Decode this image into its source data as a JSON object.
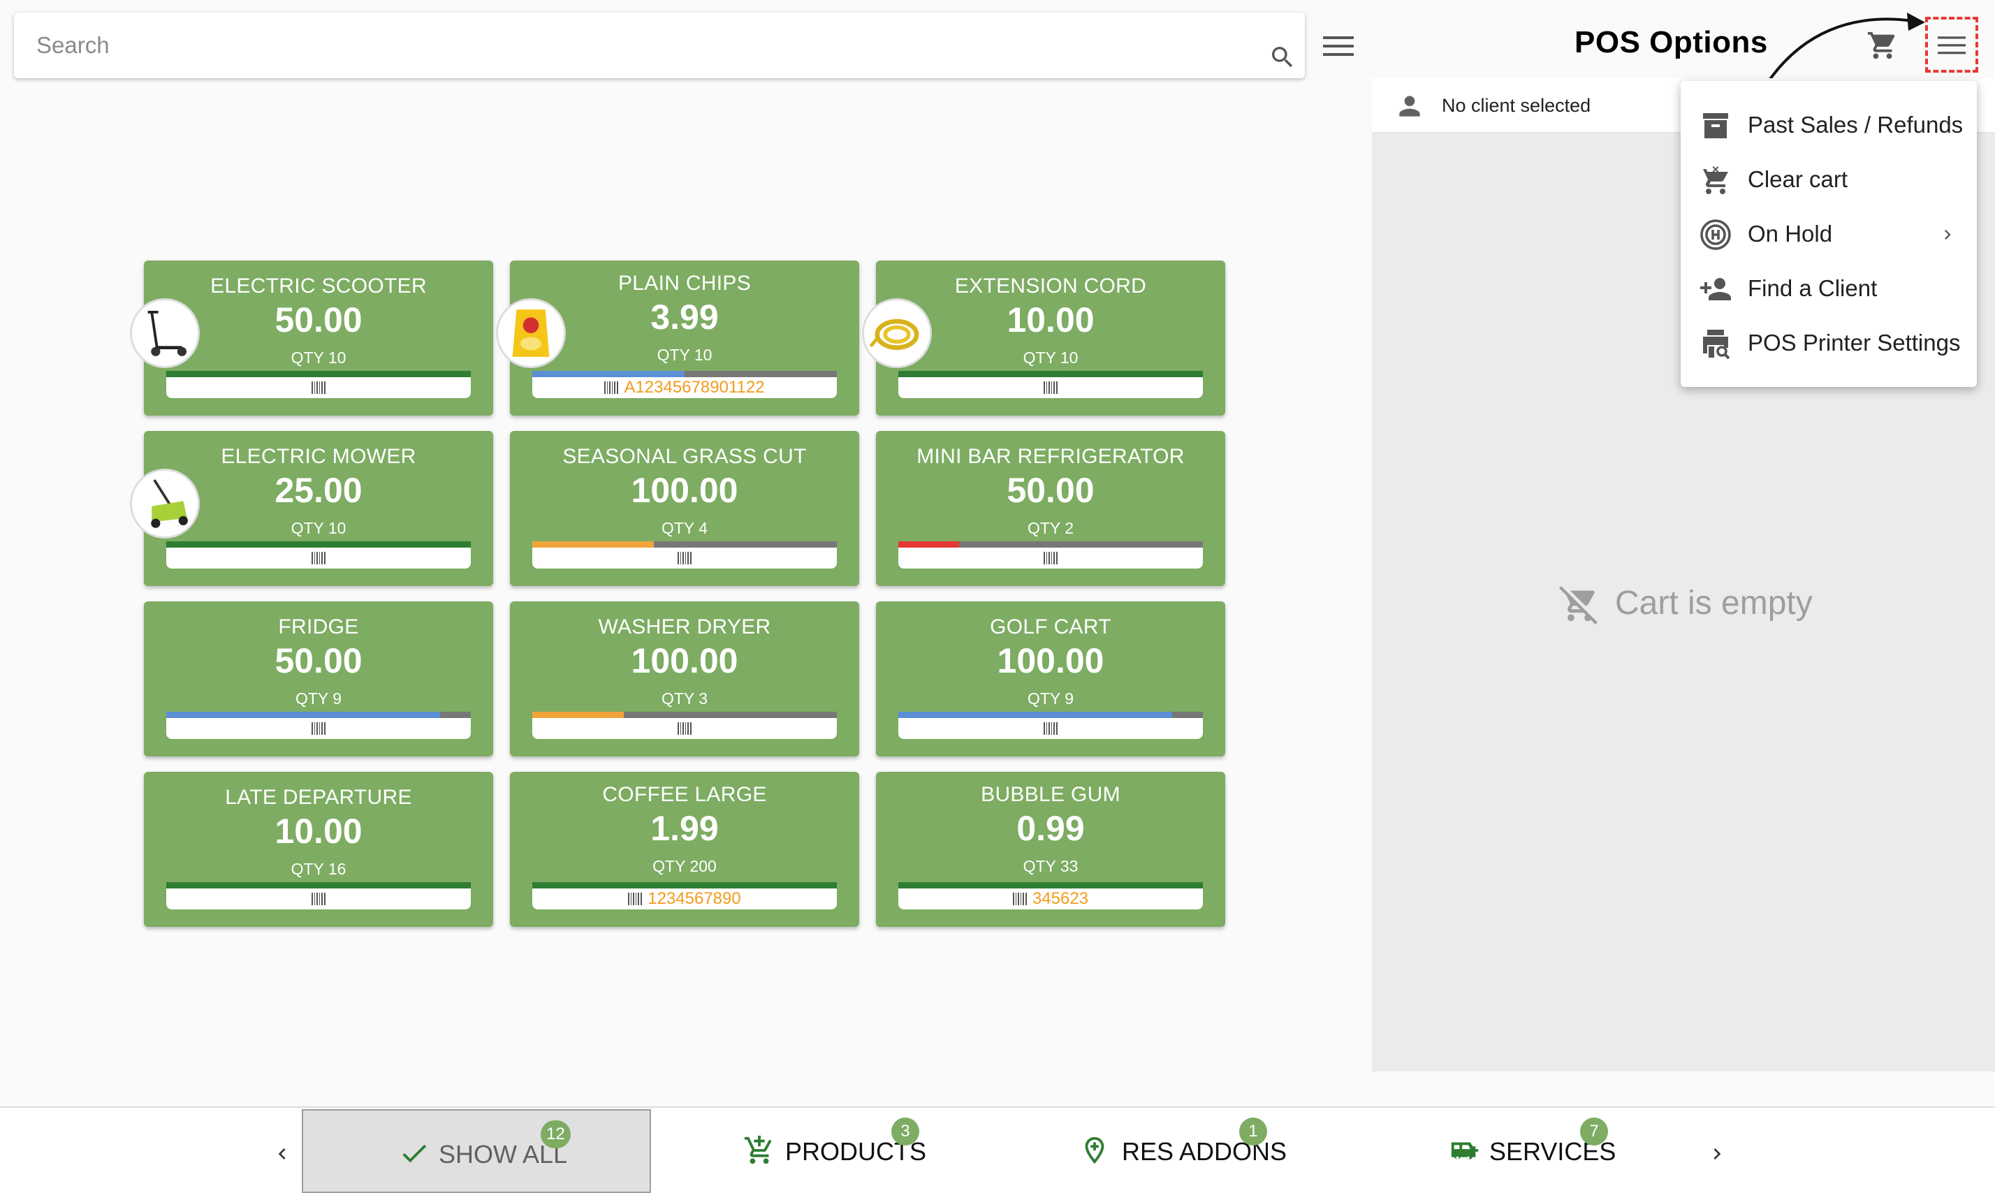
{
  "search": {
    "placeholder": "Search"
  },
  "header": {
    "pos_options_label": "POS Options"
  },
  "client": {
    "text": "No client selected"
  },
  "cart": {
    "empty_text": "Cart is empty"
  },
  "products": [
    {
      "name": "ELECTRIC SCOOTER",
      "price": "50.00",
      "qty": "QTY 10",
      "code": "",
      "stock_fraction": 1.0,
      "bar_color": "#2e7d32",
      "thumb": "scooter"
    },
    {
      "name": "PLAIN CHIPS",
      "price": "3.99",
      "qty": "QTY 10",
      "code": "A12345678901122",
      "stock_fraction": 0.5,
      "bar_color": "#5b8fd6",
      "thumb": "chips"
    },
    {
      "name": "EXTENSION CORD",
      "price": "10.00",
      "qty": "QTY 10",
      "code": "",
      "stock_fraction": 1.0,
      "bar_color": "#2e7d32",
      "thumb": "cord"
    },
    {
      "name": "ELECTRIC MOWER",
      "price": "25.00",
      "qty": "QTY 10",
      "code": "",
      "stock_fraction": 1.0,
      "bar_color": "#2e7d32",
      "thumb": "mower"
    },
    {
      "name": "SEASONAL GRASS CUT",
      "price": "100.00",
      "qty": "QTY 4",
      "code": "",
      "stock_fraction": 0.4,
      "bar_color": "#f2a33a",
      "thumb": ""
    },
    {
      "name": "MINI BAR REFRIGERATOR",
      "price": "50.00",
      "qty": "QTY 2",
      "code": "",
      "stock_fraction": 0.2,
      "bar_color": "#e53935",
      "thumb": ""
    },
    {
      "name": "FRIDGE",
      "price": "50.00",
      "qty": "QTY 9",
      "code": "",
      "stock_fraction": 0.9,
      "bar_color": "#5b8fd6",
      "thumb": ""
    },
    {
      "name": "WASHER DRYER",
      "price": "100.00",
      "qty": "QTY 3",
      "code": "",
      "stock_fraction": 0.3,
      "bar_color": "#f2a33a",
      "thumb": ""
    },
    {
      "name": "GOLF CART",
      "price": "100.00",
      "qty": "QTY 9",
      "code": "",
      "stock_fraction": 0.9,
      "bar_color": "#5b8fd6",
      "thumb": ""
    },
    {
      "name": "LATE DEPARTURE",
      "price": "10.00",
      "qty": "QTY 16",
      "code": "",
      "stock_fraction": 1.0,
      "bar_color": "#2e7d32",
      "thumb": ""
    },
    {
      "name": "COFFEE LARGE",
      "price": "1.99",
      "qty": "QTY 200",
      "code": "1234567890",
      "stock_fraction": 1.0,
      "bar_color": "#2e7d32",
      "thumb": ""
    },
    {
      "name": "BUBBLE GUM",
      "price": "0.99",
      "qty": "QTY 33",
      "code": "345623",
      "stock_fraction": 1.0,
      "bar_color": "#2e7d32",
      "thumb": ""
    }
  ],
  "pos_menu": [
    {
      "label": "Past Sales / Refunds",
      "icon": "archive-icon"
    },
    {
      "label": "Clear cart",
      "icon": "remove-shopping-cart-icon"
    },
    {
      "label": "On Hold",
      "icon": "hold-icon",
      "submenu": true
    },
    {
      "label": "Find a Client",
      "icon": "person-add-icon"
    },
    {
      "label": "POS Printer Settings",
      "icon": "printer-search-icon"
    }
  ],
  "bottom_nav": [
    {
      "label": "SHOW ALL",
      "badge": "12",
      "icon": "check-icon",
      "active": true
    },
    {
      "label": "PRODUCTS",
      "badge": "3",
      "icon": "add-cart-icon",
      "active": false
    },
    {
      "label": "RES ADDONS",
      "badge": "1",
      "icon": "location-pin-icon",
      "active": false
    },
    {
      "label": "SERVICES",
      "badge": "7",
      "icon": "rv-icon",
      "active": false
    }
  ],
  "colors": {
    "card_bg": "#7dac62",
    "badge": "#7dac62",
    "code_text": "#f29b1d",
    "highlight_box": "#e53935"
  }
}
